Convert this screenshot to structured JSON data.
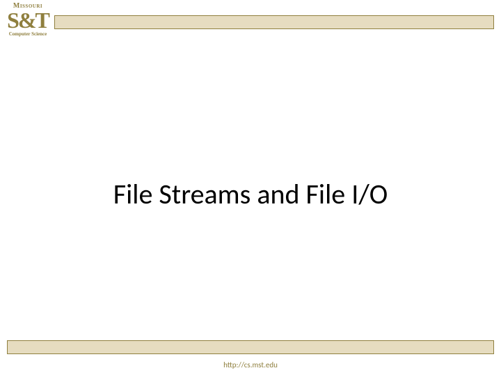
{
  "logo": {
    "line1": "Missouri",
    "line2": "S&T",
    "line3": "Computer Science"
  },
  "slide": {
    "title": "File Streams and File I/O"
  },
  "footer": {
    "url": "http://cs.mst.edu"
  }
}
